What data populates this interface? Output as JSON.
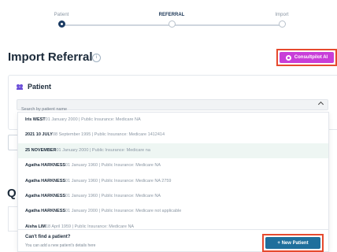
{
  "stepper": {
    "steps": [
      {
        "label": "Patient"
      },
      {
        "label": "REFERRAL"
      },
      {
        "label": "Import"
      }
    ]
  },
  "header": {
    "title": "Import Referral",
    "info_icon": "info-icon",
    "consult_label": "Consultpilot AI"
  },
  "patient": {
    "heading": "Patient",
    "search_placeholder": "Search by patient name"
  },
  "results": [
    {
      "name": "Iris WEST",
      "details": "01 January 2000 | Public Insurance: Medicare NA"
    },
    {
      "name": "2021 10 JULY",
      "details": "08 September 1995 | Public Insurance: Medicare 1412414"
    },
    {
      "name": "25 NOVEMBER",
      "details": "01 January 2000 | Public Insurance: Medicare na"
    },
    {
      "name": "Agatha HARKNESS",
      "details": "01 January 1960 | Public Insurance: Medicare NA"
    },
    {
      "name": "Agatha HARKNESS",
      "details": "01 January 1960 | Public Insurance: Medicare NA 2759"
    },
    {
      "name": "Agatha HARKNESS",
      "details": "01 January 1960 | Public Insurance: Medicare NA"
    },
    {
      "name": "Agatha HARKNESS",
      "details": "01 January 2000 | Public Insurance: Medicare not applicable"
    },
    {
      "name": "Aisha LIM",
      "details": "18 April 1959 | Public Insurance: Medicare NA"
    }
  ],
  "footer": {
    "title": "Can't find a patient?",
    "subtitle": "You can add a new patient's details here",
    "new_patient_label": "+ New Patient"
  },
  "background": {
    "section_letter": "Q"
  },
  "colors": {
    "accent_purple": "#c83ed8",
    "primary_blue": "#1f6f9c",
    "highlight_red": "#e64a2e",
    "navy": "#1b3b63"
  }
}
